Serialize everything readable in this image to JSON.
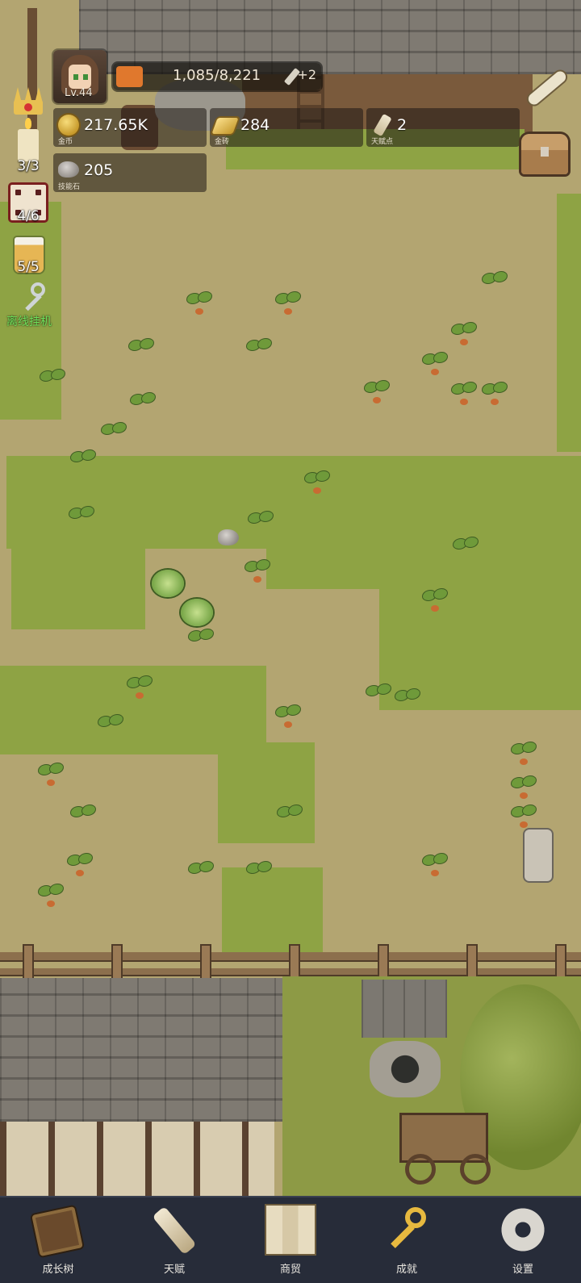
{
  "player": {
    "level": "Lv.44"
  },
  "xp": {
    "value": "1,085/8,221",
    "bonus": "+2",
    "fill_fraction": 0.13
  },
  "resources": [
    {
      "value": "217.65K",
      "label": "金币",
      "icon": "gold-coin-icon"
    },
    {
      "value": "284",
      "label": "金砖",
      "icon": "gold-bar-icon"
    },
    {
      "value": "2",
      "label": "天赋点",
      "icon": "talent-scroll-icon"
    },
    {
      "value": "205",
      "label": "技能石",
      "icon": "skill-stone-icon"
    }
  ],
  "side": {
    "candle_count": "3/3",
    "dice_count": "4/6",
    "beer_count": "5/5",
    "idle_label": "离线挂机"
  },
  "nav": [
    {
      "label": "成长树",
      "icon": "growth-book-icon"
    },
    {
      "label": "天赋",
      "icon": "talent-scroll-icon"
    },
    {
      "label": "商贸",
      "icon": "trade-map-icon"
    },
    {
      "label": "成就",
      "icon": "achievement-key-icon"
    },
    {
      "label": "设置",
      "icon": "settings-gear-icon"
    }
  ]
}
